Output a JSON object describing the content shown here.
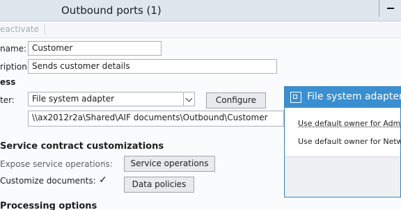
{
  "window": {
    "title": "Outbound ports (1)"
  },
  "toolbar": {
    "deactivate_label": "eactivate"
  },
  "form": {
    "name_label": "name:",
    "name_value": "Customer",
    "description_label": "ription:",
    "description_value": "Sends customer details",
    "process_section": "ess",
    "adapter_label": "ter:",
    "adapter_value": "File system adapter",
    "configure_label": "Configure",
    "path_value": "\\\\ax2012r2a\\Shared\\AIF documents\\Outbound\\Customer",
    "service_contract_section": "Service contract customizations",
    "expose_label": "Expose service operations:",
    "expose_checked": true,
    "service_operations_label": "Service operations",
    "customize_label": "Customize documents:",
    "customize_checked": true,
    "data_policies_label": "Data policies",
    "processing_section": "Processing options"
  },
  "dialog": {
    "title": "File system adapter c",
    "line1": "Use default owner for Admin",
    "line2": "Use default owner for Netwo"
  }
}
